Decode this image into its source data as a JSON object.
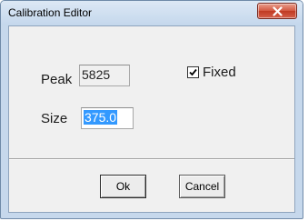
{
  "window": {
    "title": "Calibration Editor",
    "close_icon": "close-x-icon"
  },
  "peak": {
    "label": "Peak",
    "value": "5825"
  },
  "fixed": {
    "label": "Fixed",
    "checked": true
  },
  "size": {
    "label": "Size",
    "value": "375.0"
  },
  "buttons": {
    "ok": "Ok",
    "cancel": "Cancel"
  },
  "colors": {
    "selection": "#3399ff",
    "close_button": "#c83c24",
    "title_bar": "#c6d8ec"
  }
}
